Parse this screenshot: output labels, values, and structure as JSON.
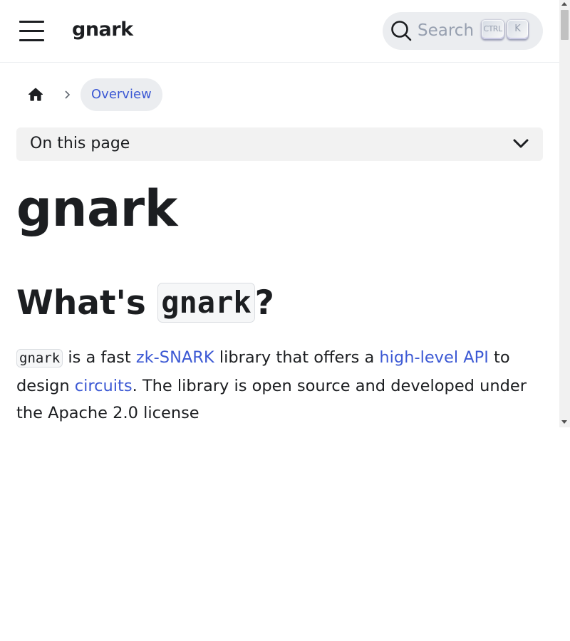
{
  "navbar": {
    "brand": "gnark",
    "menu_icon": "hamburger-menu-icon",
    "search": {
      "placeholder": "Search",
      "key_ctrl": "CTRL",
      "key_k": "K",
      "icon": "search-icon"
    }
  },
  "breadcrumbs": {
    "home_icon": "home-icon",
    "separator_icon": "chevron-right-icon",
    "current": "Overview"
  },
  "toc": {
    "label": "On this page",
    "icon": "chevron-down-icon"
  },
  "content": {
    "title": "gnark",
    "heading": {
      "prefix": "What's ",
      "code": "gnark",
      "suffix": "?"
    },
    "paragraph": {
      "code": "gnark",
      "t1": " is a fast ",
      "link1": "zk-SNARK",
      "t2": " library that offers a ",
      "link2": "high-level API",
      "t3": " to design ",
      "link3": "circuits",
      "t4": ". The library is open source and developed under the Apache 2.0 license"
    }
  },
  "colors": {
    "link": "#3c59d4",
    "text": "#1c1e21",
    "search_bg": "#ebedf0"
  }
}
